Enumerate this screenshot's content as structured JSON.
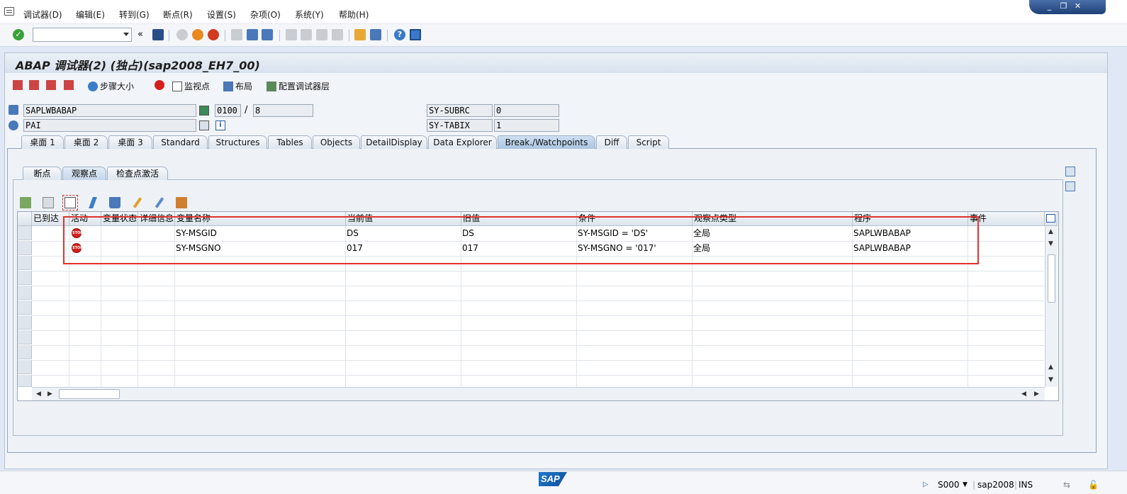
{
  "menu": {
    "items": [
      "调试器(D)",
      "编辑(E)",
      "转到(G)",
      "断点(R)",
      "设置(S)",
      "杂项(O)",
      "系统(Y)",
      "帮助(H)"
    ]
  },
  "window_controls": {
    "minimize": "_",
    "restore": "❐",
    "close": "✕"
  },
  "title": "ABAP 调试器(2) (独占)(sap2008_EH7_00)",
  "app_toolbar": {
    "step_size": "步骤大小",
    "watchpoint": "监视点",
    "layout": "布局",
    "config_layers": "配置调试器层"
  },
  "fields": {
    "program": "SAPLWBABAP",
    "screen_no": "0100",
    "slash": "/",
    "screen_line": "8",
    "event": "PAI",
    "sy_subrc_label": "SY-SUBRC",
    "sy_subrc_value": "0",
    "sy_tabix_label": "SY-TABIX",
    "sy_tabix_value": "1"
  },
  "tabs": [
    "桌面 1",
    "桌面 2",
    "桌面 3",
    "Standard",
    "Structures",
    "Tables",
    "Objects",
    "DetailDisplay",
    "Data Explorer",
    "Break./Watchpoints",
    "Diff",
    "Script"
  ],
  "active_tab": "Break./Watchpoints",
  "subtabs": [
    "断点",
    "观察点",
    "检查点激活"
  ],
  "active_subtab": "观察点",
  "grid": {
    "columns": [
      "已到达",
      "活动",
      "变量状态",
      "详细信息",
      "变量名称",
      "当前值",
      "旧值",
      "条件",
      "观察点类型",
      "程序",
      "事件"
    ],
    "rows": [
      {
        "active": "STOP",
        "variable": "SY-MSGID",
        "current": "DS",
        "old": "DS",
        "condition": "SY-MSGID = 'DS'",
        "type": "全局",
        "program": "SAPLWBABAP"
      },
      {
        "active": "STOP",
        "variable": "SY-MSGNO",
        "current": "017",
        "old": "017",
        "condition": "SY-MSGNO = '017'",
        "type": "全局",
        "program": "SAPLWBABAP"
      }
    ]
  },
  "status_bar": {
    "logo": "SAP",
    "session": "S000",
    "system": "sap2008",
    "mode": "INS"
  },
  "colors": {
    "highlight": "#e0322e",
    "stop": "#d4201c",
    "accent": "#1e3f78"
  }
}
